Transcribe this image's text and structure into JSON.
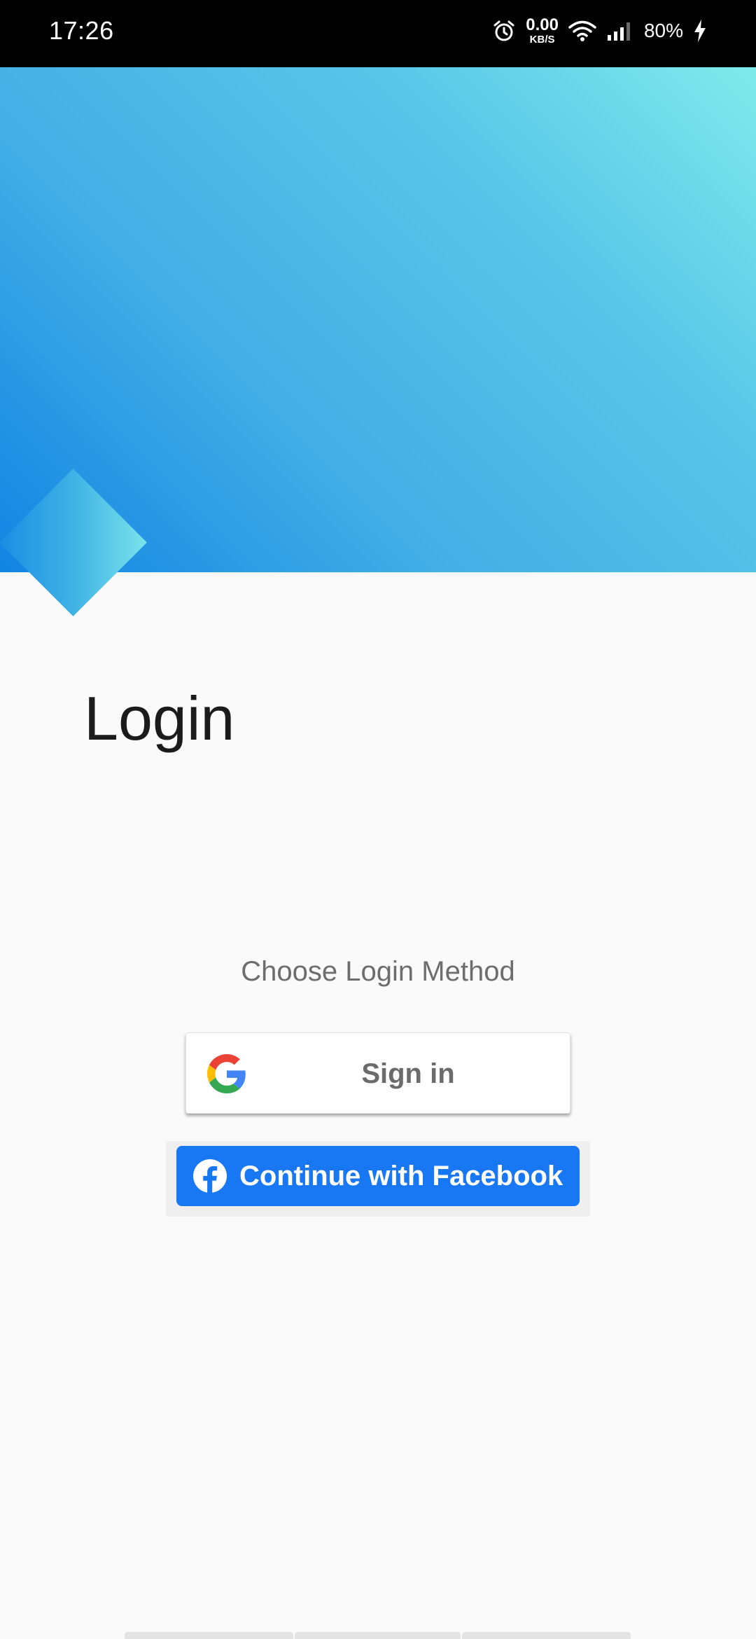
{
  "status_bar": {
    "time": "17:26",
    "net_speed_value": "0.00",
    "net_speed_unit": "KB/S",
    "battery": "80%",
    "icons": [
      "alarm-icon",
      "wifi-icon",
      "signal-icon",
      "charging-icon"
    ]
  },
  "page": {
    "title": "Login",
    "choose_label": "Choose Login Method"
  },
  "google_button": {
    "label": "Sign in",
    "icon": "google-icon"
  },
  "facebook_button": {
    "label": "Continue with Facebook",
    "icon": "facebook-icon",
    "color": "#1877f2"
  },
  "colors": {
    "hero_gradient": [
      "#80eaea",
      "#58c6e8",
      "#42aee5",
      "#1284e3"
    ],
    "background": "#fafafa"
  }
}
